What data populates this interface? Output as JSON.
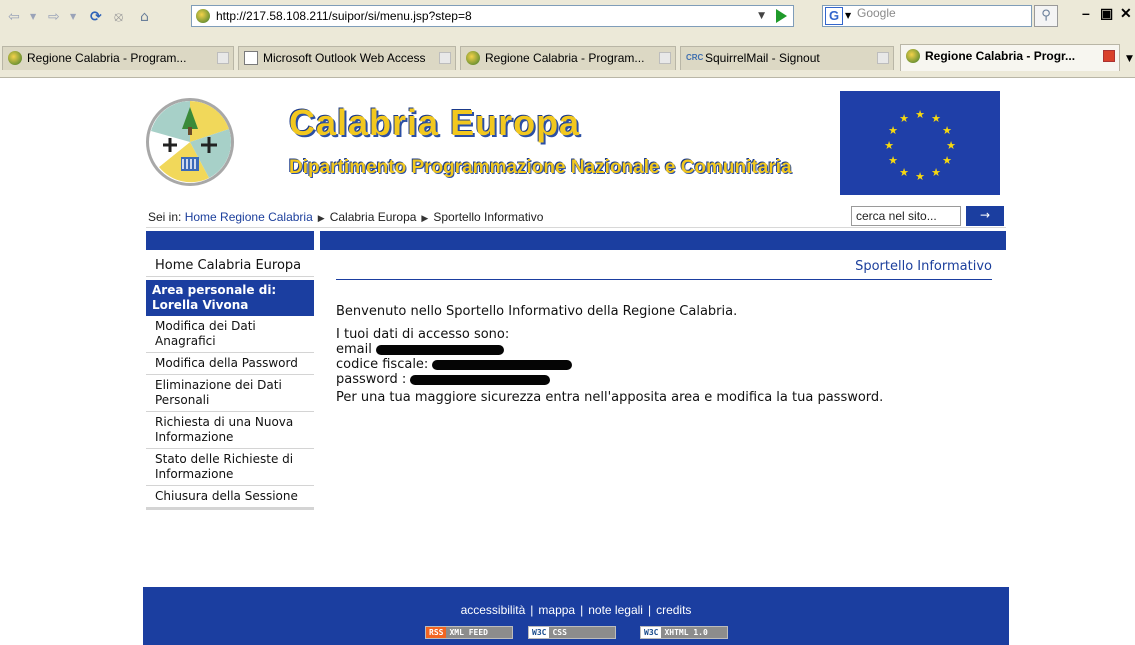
{
  "browser": {
    "url": "http://217.58.108.211/suipor/si/menu.jsp?step=8",
    "search_engine_placeholder": "Google",
    "tabs": [
      {
        "label": "Regione Calabria - Program...",
        "icon": "globe-icon",
        "active": false
      },
      {
        "label": "Microsoft Outlook Web Access",
        "icon": "page-icon",
        "active": false
      },
      {
        "label": "Regione Calabria - Program...",
        "icon": "globe-icon",
        "active": false
      },
      {
        "label": "SquirrelMail - Signout",
        "icon": "crc-icon",
        "active": false
      },
      {
        "label": "Regione Calabria - Progr...",
        "icon": "globe-icon",
        "active": true
      }
    ]
  },
  "header": {
    "title": "Calabria Europa",
    "subtitle": "Dipartimento Programmazione Nazionale e Comunitaria"
  },
  "breadcrumb": {
    "prefix": "Sei in:",
    "items": [
      "Home Regione Calabria",
      "Calabria Europa",
      "Sportello Informativo"
    ]
  },
  "site_search": {
    "placeholder": "cerca nel sito...",
    "button": "→"
  },
  "sidebar": {
    "home": "Home Calabria Europa",
    "area_label": "Area personale di:",
    "area_user": "Lorella Vivona",
    "items": [
      "Modifica dei Dati Anagrafici",
      "Modifica della Password",
      "Eliminazione dei Dati Personali",
      "Richiesta di una Nuova Informazione",
      "Stato delle Richieste di Informazione",
      "Chiusura della Sessione"
    ]
  },
  "content": {
    "section_title": "Sportello Informativo",
    "welcome": "Benvenuto nello Sportello Informativo della Regione Calabria.",
    "access_intro": "I tuoi dati di accesso sono:",
    "email_label": "email",
    "codice_label": "codice fiscale:",
    "password_label": "password :",
    "security_note": "Per una tua maggiore sicurezza entra nell'apposita area e modifica la tua password."
  },
  "footer": {
    "links": [
      "accessibilità",
      "mappa",
      "note legali",
      "credits"
    ],
    "badges": [
      {
        "left": "RSS",
        "right": "XML FEED"
      },
      {
        "left": "W3C",
        "right": "CSS"
      },
      {
        "left": "W3C",
        "right": "XHTML 1.0"
      }
    ]
  },
  "colors": {
    "brand_blue": "#1b3ea0",
    "title_yellow": "#f2c81f",
    "link_blue": "#1c3f9c"
  }
}
